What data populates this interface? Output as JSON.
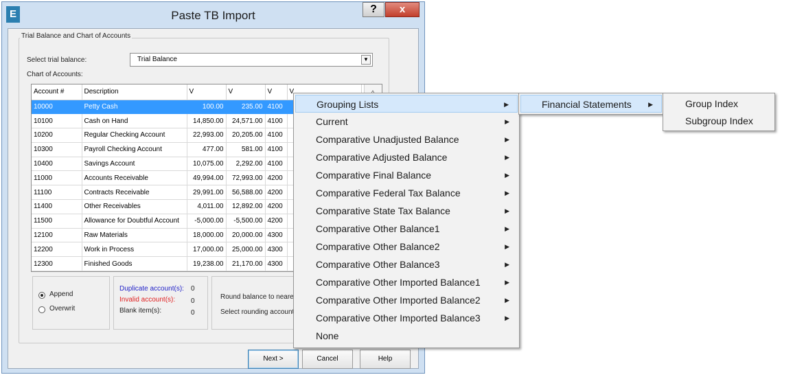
{
  "window": {
    "icon_letter": "E",
    "title": "Paste TB Import",
    "help_glyph": "?",
    "close_glyph": "x"
  },
  "group": {
    "legend": "Trial Balance and Chart of Accounts",
    "select_label": "Select trial balance:",
    "select_value": "Trial Balance",
    "coa_label": "Chart of Accounts:"
  },
  "table": {
    "headers": [
      "Account #",
      "Description",
      "V",
      "V",
      "V",
      "V"
    ],
    "rows": [
      {
        "acct": "10000",
        "desc": "Petty Cash",
        "v1": "100.00",
        "v2": "235.00",
        "v3": "4100"
      },
      {
        "acct": "10100",
        "desc": "Cash on Hand",
        "v1": "14,850.00",
        "v2": "24,571.00",
        "v3": "4100"
      },
      {
        "acct": "10200",
        "desc": "Regular Checking Account",
        "v1": "22,993.00",
        "v2": "20,205.00",
        "v3": "4100"
      },
      {
        "acct": "10300",
        "desc": "Payroll Checking Account",
        "v1": "477.00",
        "v2": "581.00",
        "v3": "4100"
      },
      {
        "acct": "10400",
        "desc": "Savings Account",
        "v1": "10,075.00",
        "v2": "2,292.00",
        "v3": "4100"
      },
      {
        "acct": "11000",
        "desc": "Accounts Receivable",
        "v1": "49,994.00",
        "v2": "72,993.00",
        "v3": "4200"
      },
      {
        "acct": "11100",
        "desc": "Contracts Receivable",
        "v1": "29,991.00",
        "v2": "56,588.00",
        "v3": "4200"
      },
      {
        "acct": "11400",
        "desc": "Other Receivables",
        "v1": "4,011.00",
        "v2": "12,892.00",
        "v3": "4200"
      },
      {
        "acct": "11500",
        "desc": "Allowance for Doubtful Account",
        "v1": "-5,000.00",
        "v2": "-5,500.00",
        "v3": "4200"
      },
      {
        "acct": "12100",
        "desc": "Raw Materials",
        "v1": "18,000.00",
        "v2": "20,000.00",
        "v3": "4300"
      },
      {
        "acct": "12200",
        "desc": "Work in Process",
        "v1": "17,000.00",
        "v2": "25,000.00",
        "v3": "4300"
      },
      {
        "acct": "12300",
        "desc": "Finished Goods",
        "v1": "19,238.00",
        "v2": "21,170.00",
        "v3": "4300"
      }
    ],
    "scroll_up_glyph": "^"
  },
  "mode": {
    "append_label": "Append",
    "overwrite_label": "Overwrit"
  },
  "counts": {
    "duplicate_label": "Duplicate account(s):",
    "duplicate_value": "0",
    "invalid_label": "Invalid account(s):",
    "invalid_value": "0",
    "blank_label": "Blank item(s):",
    "blank_value": "0"
  },
  "rounding": {
    "round_label": "Round balance to neares",
    "account_label": "Select rounding account:"
  },
  "buttons": {
    "next": "Next >",
    "cancel": "Cancel",
    "help": "Help"
  },
  "menu1": {
    "items": [
      "Grouping Lists",
      "Current",
      "Comparative Unadjusted Balance",
      "Comparative Adjusted Balance",
      "Comparative Final Balance",
      "Comparative Federal Tax Balance",
      "Comparative State Tax Balance",
      "Comparative Other Balance1",
      "Comparative Other Balance2",
      "Comparative Other Balance3",
      "Comparative Other Imported Balance1",
      "Comparative Other Imported Balance2",
      "Comparative Other Imported Balance3",
      "None"
    ]
  },
  "menu2": {
    "items": [
      "Financial Statements"
    ]
  },
  "menu3": {
    "items": [
      "Group Index",
      "Subgroup Index"
    ]
  },
  "colors": {
    "selection": "#3399ff",
    "duplicate_text": "#2323c8",
    "invalid_text": "#e02020",
    "menu_highlight": "#d5e8fb"
  }
}
